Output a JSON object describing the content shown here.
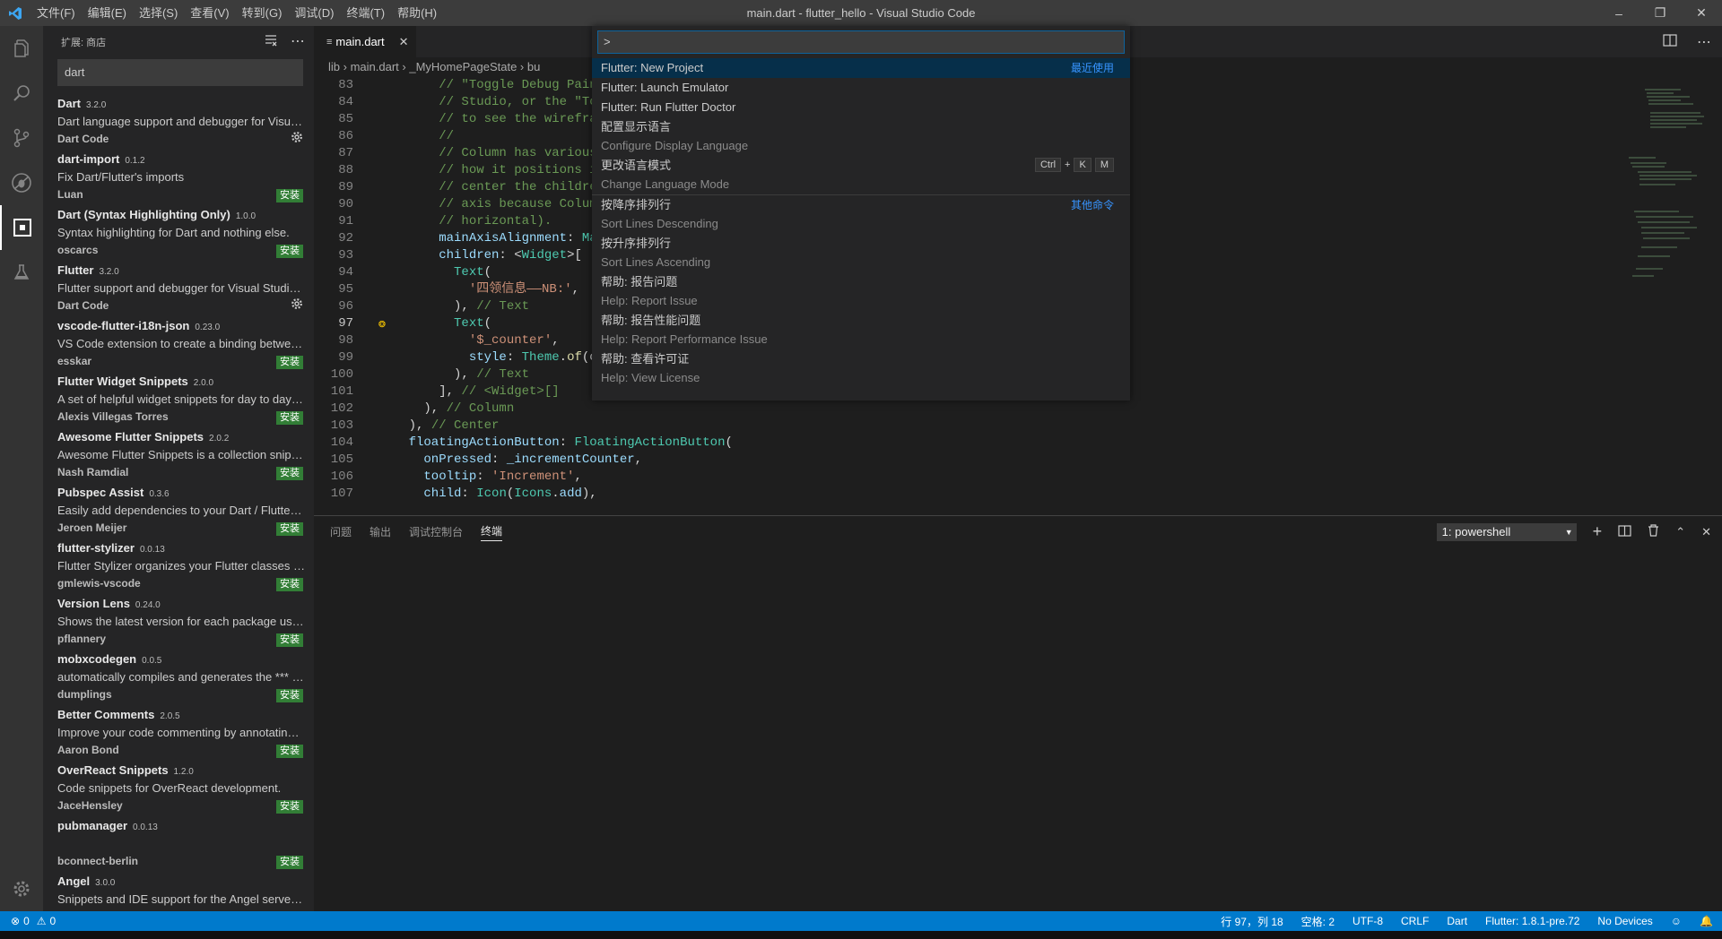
{
  "window": {
    "title": "main.dart - flutter_hello - Visual Studio Code",
    "menu": [
      "文件(F)",
      "编辑(E)",
      "选择(S)",
      "查看(V)",
      "转到(G)",
      "调试(D)",
      "终端(T)",
      "帮助(H)"
    ]
  },
  "sidebar": {
    "header": "扩展: 商店",
    "search_value": "dart",
    "extensions": [
      {
        "name": "Dart",
        "version": "3.2.0",
        "desc": "Dart language support and debugger for Visual Studio Code.",
        "publisher": "Dart Code",
        "action": "gear"
      },
      {
        "name": "dart-import",
        "version": "0.1.2",
        "desc": "Fix Dart/Flutter's imports",
        "publisher": "Luan",
        "action": "安装"
      },
      {
        "name": "Dart (Syntax Highlighting Only)",
        "version": "1.0.0",
        "desc": "Syntax highlighting for Dart and nothing else.",
        "publisher": "oscarcs",
        "action": "安装"
      },
      {
        "name": "Flutter",
        "version": "3.2.0",
        "desc": "Flutter support and debugger for Visual Studio Code.",
        "publisher": "Dart Code",
        "action": "gear"
      },
      {
        "name": "vscode-flutter-i18n-json",
        "version": "0.23.0",
        "desc": "VS Code extension to create a binding between your translations",
        "publisher": "esskar",
        "action": "安装"
      },
      {
        "name": "Flutter Widget Snippets",
        "version": "2.0.0",
        "desc": "A set of helpful widget snippets for day to day Flutter development",
        "publisher": "Alexis Villegas Torres",
        "action": "安装"
      },
      {
        "name": "Awesome Flutter Snippets",
        "version": "2.0.2",
        "desc": "Awesome Flutter Snippets is a collection snippets and shortcuts",
        "publisher": "Nash Ramdial",
        "action": "安装"
      },
      {
        "name": "Pubspec Assist",
        "version": "0.3.6",
        "desc": "Easily add dependencies to your Dart / Flutter project.",
        "publisher": "Jeroen Meijer",
        "action": "安装"
      },
      {
        "name": "flutter-stylizer",
        "version": "0.0.13",
        "desc": "Flutter Stylizer organizes your Flutter classes in an opinionated",
        "publisher": "gmlewis-vscode",
        "action": "安装"
      },
      {
        "name": "Version Lens",
        "version": "0.24.0",
        "desc": "Shows the latest version for each package using code lens",
        "publisher": "pflannery",
        "action": "安装"
      },
      {
        "name": "mobxcodegen",
        "version": "0.0.5",
        "desc": "automatically compiles and generates the *** .g.dart file",
        "publisher": "dumplings",
        "action": "安装"
      },
      {
        "name": "Better Comments",
        "version": "2.0.5",
        "desc": "Improve your code commenting by annotating with alert",
        "publisher": "Aaron Bond",
        "action": "安装"
      },
      {
        "name": "OverReact Snippets",
        "version": "1.2.0",
        "desc": "Code snippets for OverReact development.",
        "publisher": "JaceHensley",
        "action": "安装"
      },
      {
        "name": "pubmanager",
        "version": "0.0.13",
        "desc": "",
        "publisher": "bconnect-berlin",
        "action": "安装"
      },
      {
        "name": "Angel",
        "version": "3.0.0",
        "desc": "Snippets and IDE support for the Angel server-side framework",
        "publisher": "",
        "action": ""
      }
    ]
  },
  "editor": {
    "tab_label": "main.dart",
    "breadcrumb": [
      "lib",
      "main.dart",
      "_MyHomePageState",
      "bu"
    ],
    "lines": [
      {
        "n": "83",
        "t": [
          [
            "c-com",
            "        // \"Toggle Debug Paint"
          ]
        ]
      },
      {
        "n": "84",
        "t": [
          [
            "c-com",
            "        // Studio, or the \"Tog"
          ]
        ]
      },
      {
        "n": "85",
        "t": [
          [
            "c-com",
            "        // to see the wirefram"
          ]
        ]
      },
      {
        "n": "86",
        "t": [
          [
            "c-com",
            "        //"
          ]
        ]
      },
      {
        "n": "87",
        "t": [
          [
            "c-com",
            "        // Column has various "
          ]
        ]
      },
      {
        "n": "88",
        "t": [
          [
            "c-com",
            "        // how it positions it"
          ]
        ]
      },
      {
        "n": "89",
        "t": [
          [
            "c-com",
            "        // center the children"
          ]
        ]
      },
      {
        "n": "90",
        "t": [
          [
            "c-com",
            "        // axis because Column"
          ]
        ]
      },
      {
        "n": "91",
        "t": [
          [
            "c-com",
            "        // horizontal)."
          ]
        ]
      },
      {
        "n": "92",
        "t": [
          [
            "c-var",
            "        mainAxisAlignment"
          ],
          [
            "c-pl",
            ": "
          ],
          [
            "c-ty",
            "Mai"
          ]
        ]
      },
      {
        "n": "93",
        "t": [
          [
            "c-var",
            "        children"
          ],
          [
            "c-pl",
            ": <"
          ],
          [
            "c-ty",
            "Widget"
          ],
          [
            "c-pl",
            ">["
          ]
        ]
      },
      {
        "n": "94",
        "t": [
          [
            "c-ty",
            "          Text"
          ],
          [
            "c-pl",
            "("
          ]
        ]
      },
      {
        "n": "95",
        "t": [
          [
            "c-str",
            "            '四领信息——NB:'"
          ],
          [
            "c-pl",
            ","
          ]
        ]
      },
      {
        "n": "96",
        "t": [
          [
            "c-pl",
            "          ), "
          ],
          [
            "c-com",
            "// Text"
          ]
        ]
      },
      {
        "n": "97",
        "t": [
          [
            "c-ty",
            "          Text"
          ],
          [
            "c-pl",
            "("
          ]
        ]
      },
      {
        "n": "98",
        "t": [
          [
            "c-str",
            "            '$_counter'"
          ],
          [
            "c-pl",
            ","
          ]
        ]
      },
      {
        "n": "99",
        "t": [
          [
            "c-var",
            "            style"
          ],
          [
            "c-pl",
            ": "
          ],
          [
            "c-ty",
            "Theme"
          ],
          [
            "c-pl",
            "."
          ],
          [
            "c-fn",
            "of"
          ],
          [
            "c-pl",
            "(co"
          ]
        ]
      },
      {
        "n": "100",
        "t": [
          [
            "c-pl",
            "          ), "
          ],
          [
            "c-com",
            "// Text"
          ]
        ]
      },
      {
        "n": "101",
        "t": [
          [
            "c-pl",
            "        ], "
          ],
          [
            "c-com",
            "// <Widget>[]"
          ]
        ]
      },
      {
        "n": "102",
        "t": [
          [
            "c-pl",
            "      ), "
          ],
          [
            "c-com",
            "// Column"
          ]
        ]
      },
      {
        "n": "103",
        "t": [
          [
            "c-pl",
            "    ), "
          ],
          [
            "c-com",
            "// Center"
          ]
        ]
      },
      {
        "n": "104",
        "t": [
          [
            "c-var",
            "    floatingActionButton"
          ],
          [
            "c-pl",
            ": "
          ],
          [
            "c-ty",
            "FloatingActionButton"
          ],
          [
            "c-pl",
            "("
          ]
        ]
      },
      {
        "n": "105",
        "t": [
          [
            "c-var",
            "      onPressed"
          ],
          [
            "c-pl",
            ": "
          ],
          [
            "c-var",
            "_incrementCounter"
          ],
          [
            "c-pl",
            ","
          ]
        ]
      },
      {
        "n": "106",
        "t": [
          [
            "c-var",
            "      tooltip"
          ],
          [
            "c-pl",
            ": "
          ],
          [
            "c-str",
            "'Increment'"
          ],
          [
            "c-pl",
            ","
          ]
        ]
      },
      {
        "n": "107",
        "t": [
          [
            "c-var",
            "      child"
          ],
          [
            "c-pl",
            ": "
          ],
          [
            "c-ty",
            "Icon"
          ],
          [
            "c-pl",
            "("
          ],
          [
            "c-ty",
            "Icons"
          ],
          [
            "c-pl",
            "."
          ],
          [
            "c-var",
            "add"
          ],
          [
            "c-pl",
            "),"
          ]
        ]
      }
    ]
  },
  "palette": {
    "input_value": ">",
    "items": [
      {
        "label": "Flutter: New Project",
        "sub": "",
        "tag": "最近使用",
        "selected": true
      },
      {
        "label": "Flutter: Launch Emulator",
        "sub": ""
      },
      {
        "label": "Flutter: Run Flutter Doctor",
        "sub": ""
      },
      {
        "label": "配置显示语言",
        "sub": "Configure Display Language"
      },
      {
        "label": "更改语言模式",
        "sub": "Change Language Mode",
        "keys": [
          "Ctrl",
          "+",
          "K",
          "M"
        ]
      },
      {
        "label": "按降序排列行",
        "sub": "Sort Lines Descending",
        "tag": "其他命令",
        "sep": true
      },
      {
        "label": "按升序排列行",
        "sub": "Sort Lines Ascending"
      },
      {
        "label": "帮助: 报告问题",
        "sub": "Help: Report Issue"
      },
      {
        "label": "帮助: 报告性能问题",
        "sub": "Help: Report Performance Issue"
      },
      {
        "label": "帮助: 查看许可证",
        "sub": "Help: View License"
      }
    ]
  },
  "panel": {
    "tabs": [
      "问题",
      "输出",
      "调试控制台",
      "终端"
    ],
    "active_tab": "终端",
    "terminal_select": "1: powershell"
  },
  "statusbar": {
    "errors": "0",
    "warnings": "0",
    "position": "行 97，列 18",
    "spaces": "空格: 2",
    "encoding": "UTF-8",
    "eol": "CRLF",
    "language": "Dart",
    "flutter": "Flutter: 1.8.1-pre.72",
    "devices": "No Devices"
  },
  "colors": {
    "accent": "#007acc",
    "install": "#327e36",
    "selected": "#062f4a"
  }
}
